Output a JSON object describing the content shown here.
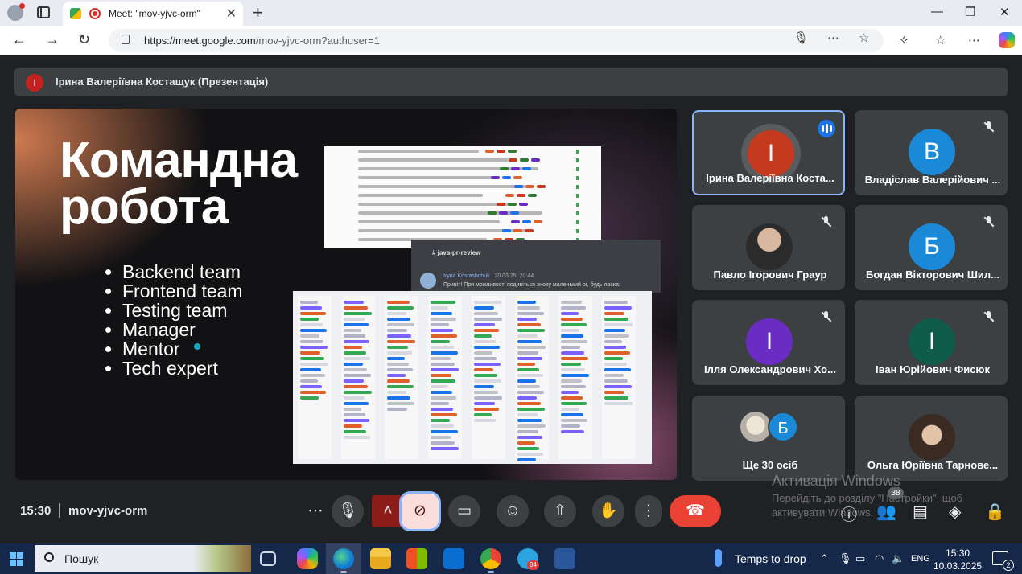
{
  "browser": {
    "tab_title": "Meet: \"mov-yjvc-orm\"",
    "url_host": "https://meet.google.com",
    "url_path": "/mov-yjvc-orm?authuser=1"
  },
  "meeting": {
    "presenter_initial": "I",
    "presenter_banner": "Ірина Валеріївна Костащук (Презентація)",
    "time": "15:30",
    "code": "mov-yjvc-orm",
    "participant_count": "38"
  },
  "slide": {
    "title_line1": "Командна",
    "title_line2": "робота",
    "bullets": [
      "Backend team",
      "Frontend team",
      "Testing team",
      "Manager",
      "Mentor",
      "Tech expert"
    ],
    "chat_channel": "java-pr-review",
    "chat_author": "Iryna Kostashchuk",
    "chat_time": "20.03.25, 20:44",
    "chat_message": "Привіт! При можливості подивіться знову маленький pr, будь ласка:"
  },
  "participants": [
    {
      "name": "Ірина Валеріївна Коста...",
      "initial": "I",
      "color": "#c5391f",
      "speaking": true
    },
    {
      "name": "Владіслав Валерійович ...",
      "initial": "В",
      "color": "#1a8ad8"
    },
    {
      "name": "Павло Ігорович Граур",
      "initial": "",
      "color": "#2b2b2b"
    },
    {
      "name": "Богдан Вікторович Шил...",
      "initial": "Б",
      "color": "#1a8ad8"
    },
    {
      "name": "Ілля Олександрович Хо...",
      "initial": "I",
      "color": "#6a2cc2"
    },
    {
      "name": "Іван Юрійович Фисюк",
      "initial": "I",
      "color": "#0f5c4a"
    },
    {
      "name": "Ще 30 осіб",
      "initial": "Б",
      "color": "#1a8ad8"
    },
    {
      "name": "Ольга Юріївна Тарнове...",
      "initial": "",
      "color": "#3a2a22"
    }
  ],
  "windows": {
    "watermark_title": "Активація Windows",
    "watermark_text": "Перейдіть до розділу \"Настройки\", щоб активувати Windows.",
    "search_placeholder": "Пошук",
    "weather": "Temps to drop",
    "lang": "ENG",
    "time": "15:30",
    "date": "10.03.2025",
    "notifications": "2",
    "telegram_badge": "84"
  }
}
